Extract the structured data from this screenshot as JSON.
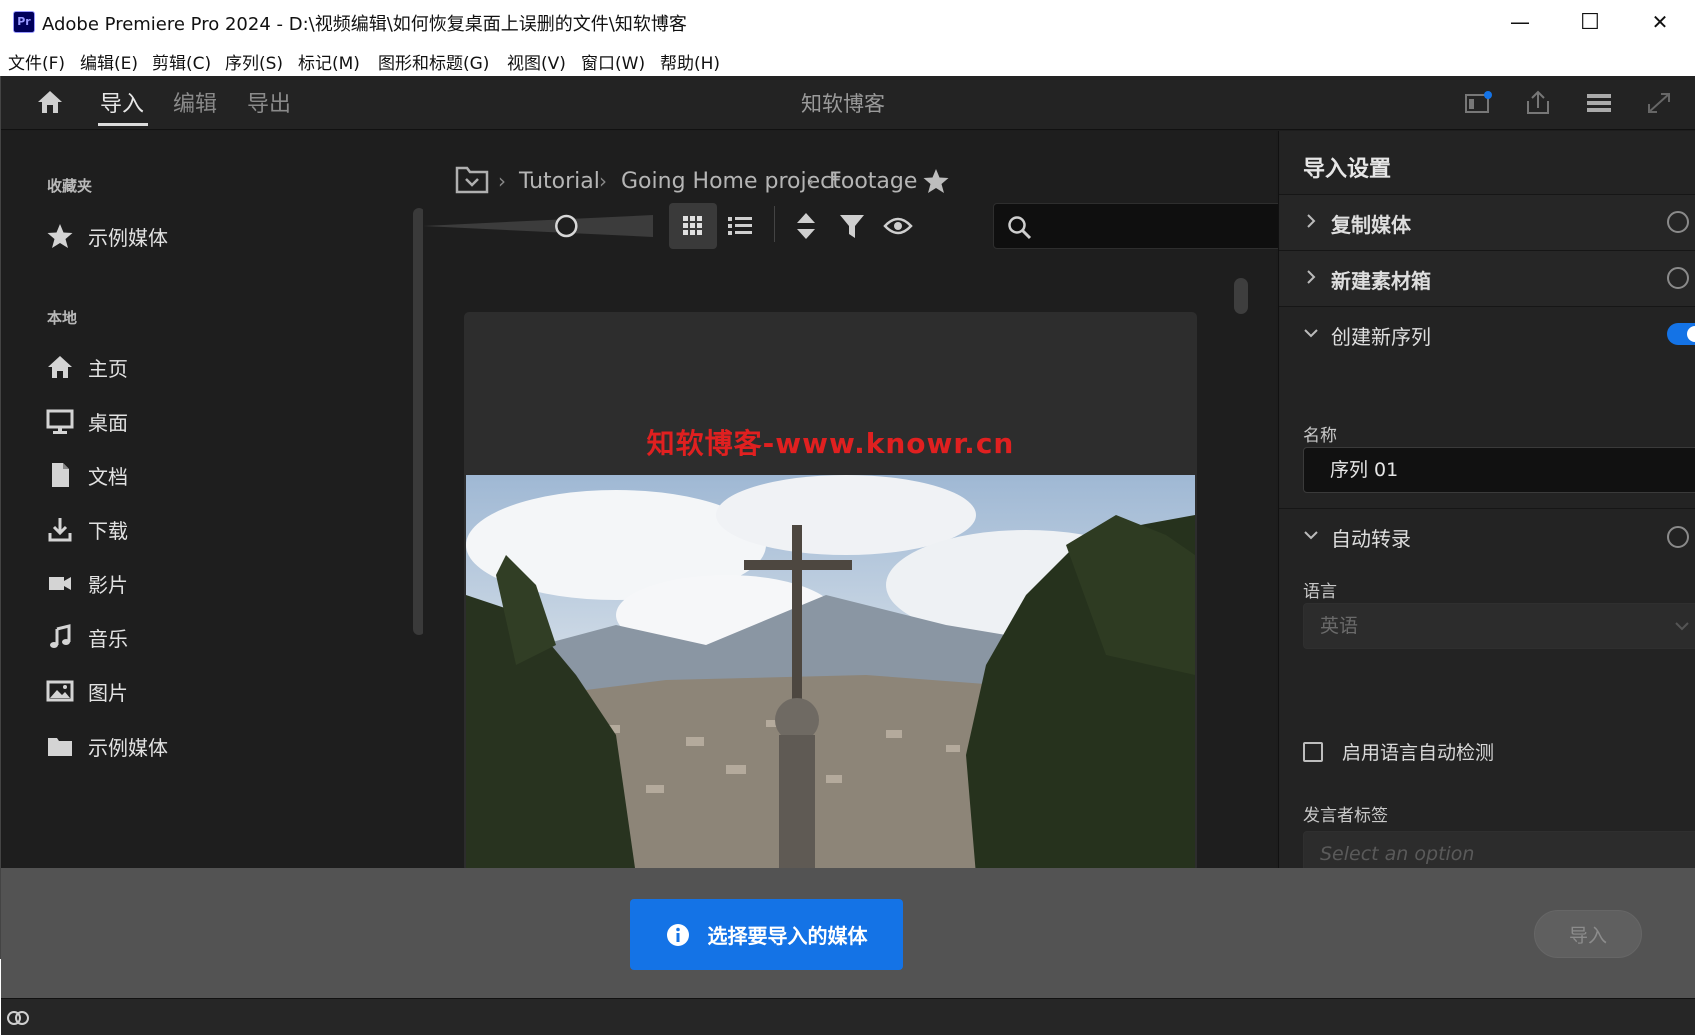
{
  "window": {
    "title": "Adobe Premiere Pro 2024 - D:\\视频编辑\\如何恢复桌面上误删的文件\\知软博客",
    "app_icon_label": "Pr",
    "minimize": "—",
    "maximize": "☐",
    "close": "✕"
  },
  "menu": [
    "文件(F)",
    "编辑(E)",
    "剪辑(C)",
    "序列(S)",
    "标记(M)",
    "图形和标题(G)",
    "视图(V)",
    "窗口(W)",
    "帮助(H)"
  ],
  "header": {
    "tabs": [
      "导入",
      "编辑",
      "导出"
    ],
    "active_tab": "导入",
    "project_name": "知软博客"
  },
  "sidebar": {
    "favorites_heading": "收藏夹",
    "favorites": [
      {
        "label": "示例媒体",
        "icon": "star-icon"
      }
    ],
    "local_heading": "本地",
    "local": [
      {
        "label": "主页",
        "icon": "home-icon"
      },
      {
        "label": "桌面",
        "icon": "desktop-icon"
      },
      {
        "label": "文档",
        "icon": "document-icon"
      },
      {
        "label": "下载",
        "icon": "download-icon"
      },
      {
        "label": "影片",
        "icon": "video-camera-icon"
      },
      {
        "label": "音乐",
        "icon": "music-note-icon"
      },
      {
        "label": "图片",
        "icon": "picture-icon"
      },
      {
        "label": "示例媒体",
        "icon": "folder-icon"
      }
    ]
  },
  "browser": {
    "breadcrumb": [
      "Tutorial",
      "Going Home project",
      "Footage"
    ],
    "search_value": "",
    "thumbnail_watermark": "知软博客-www.knowr.cn",
    "zoom_fraction": 0.62
  },
  "import_settings": {
    "title": "导入设置",
    "copy_media": {
      "label": "复制媒体",
      "enabled": false
    },
    "new_bin": {
      "label": "新建素材箱",
      "enabled": false
    },
    "create_sequence": {
      "label": "创建新序列",
      "enabled": true,
      "name_label": "名称",
      "name_value": "序列 01"
    },
    "auto_transcribe": {
      "label": "自动转录",
      "enabled": false,
      "language_label": "语言",
      "language_value": "英语",
      "auto_detect_label": "启用语言自动检测",
      "auto_detect_checked": false,
      "speaker_label": "发言者标签",
      "speaker_placeholder": "Select an option"
    }
  },
  "footer": {
    "select_media_label": "选择要导入的媒体",
    "import_label": "导入"
  },
  "colors": {
    "accent": "#1473e6",
    "watermark": "#e02020"
  }
}
